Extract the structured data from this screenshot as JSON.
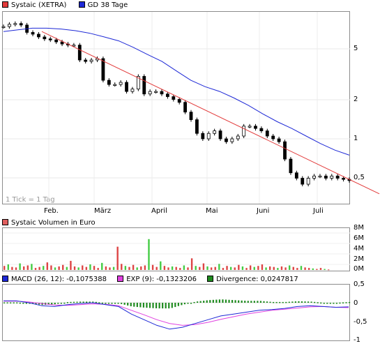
{
  "legend_price": [
    {
      "label": "Systaic (XETRA)",
      "color": "#e23a3a"
    },
    {
      "label": "GD 38 Tage",
      "color": "#1d28d6"
    }
  ],
  "legend_volume": {
    "label": "Systaic Volumen in Euro",
    "color": "#e06060"
  },
  "legend_macd": [
    {
      "label": "MACD (26, 12): -0,1075388",
      "color": "#1d28d6"
    },
    {
      "label": "EXP (9): -0,1323206",
      "color": "#e040e0"
    },
    {
      "label": "Divergence: 0,0247817",
      "color": "#1e8a1e"
    }
  ],
  "tick_note": "1 Tick = 1 Tag",
  "chart_data": [
    {
      "type": "candlestick",
      "title": "Systaic (XETRA)",
      "yscale": "log",
      "y_ticks": [
        "5",
        "2",
        "1",
        "0,5"
      ],
      "x_ticks": [
        "Feb.",
        "März",
        "April",
        "Mai",
        "Juni",
        "Juli"
      ],
      "series": [
        {
          "name": "Systaic (XETRA)",
          "values": [
            7.2,
            7.5,
            7.6,
            7.4,
            6.5,
            6.3,
            6.0,
            5.8,
            5.7,
            5.5,
            5.3,
            5.2,
            5.2,
            4.0,
            3.9,
            4.0,
            4.1,
            2.8,
            2.6,
            2.6,
            2.7,
            2.3,
            2.4,
            3.0,
            2.2,
            2.3,
            2.3,
            2.2,
            2.1,
            2.0,
            1.9,
            1.6,
            1.4,
            1.1,
            1.0,
            1.1,
            1.15,
            1.0,
            0.95,
            1.0,
            1.05,
            1.25,
            1.25,
            1.2,
            1.15,
            1.05,
            1.0,
            0.95,
            0.7,
            0.55,
            0.5,
            0.45,
            0.5,
            0.52,
            0.52,
            0.5,
            0.52,
            0.5,
            0.49,
            0.48
          ]
        },
        {
          "name": "GD 38 Tage",
          "values": [
            6.6,
            6.8,
            7.0,
            7.0,
            6.9,
            6.7,
            6.4,
            6.0,
            5.6,
            5.0,
            4.4,
            3.9,
            3.3,
            2.8,
            2.5,
            2.3,
            2.05,
            1.8,
            1.55,
            1.35,
            1.2,
            1.05,
            0.92,
            0.82,
            0.75
          ]
        }
      ],
      "trendline": {
        "from": 6.6,
        "to": 0.55
      }
    },
    {
      "type": "bar",
      "title": "Systaic Volumen in Euro",
      "y_ticks": [
        "8M",
        "6M",
        "4M",
        "2M",
        "0M"
      ],
      "ylim": [
        0,
        8
      ],
      "values": [
        0.8,
        1.1,
        0.6,
        0.5,
        1.3,
        0.7,
        0.9,
        1.2,
        0.4,
        0.6,
        0.8,
        1.5,
        0.9,
        0.5,
        0.7,
        1.0,
        0.6,
        1.8,
        0.7,
        0.5,
        0.9,
        0.6,
        1.1,
        0.8,
        0.4,
        1.4,
        0.7,
        0.5,
        0.6,
        4.6,
        1.2,
        0.8,
        0.6,
        1.0,
        0.5,
        0.7,
        0.9,
        6.1,
        1.0,
        0.6,
        1.7,
        0.8,
        0.5,
        0.7,
        0.6,
        0.4,
        0.9,
        0.5,
        2.3,
        0.8,
        0.6,
        1.3,
        0.7,
        0.5,
        0.6,
        1.2,
        0.4,
        0.8,
        0.6,
        0.5,
        1.0,
        0.7,
        0.4,
        0.9,
        0.6,
        0.8,
        1.1,
        0.5,
        0.7,
        0.6,
        0.4,
        0.7,
        0.5,
        0.9,
        0.6,
        0.4,
        0.8,
        0.5,
        0.4,
        0.3,
        0.2,
        0.4,
        0.2,
        0.1
      ]
    },
    {
      "type": "line",
      "title": "MACD",
      "y_ticks": [
        "0,5",
        "0",
        "-0,5",
        "-1"
      ],
      "ylim": [
        -1,
        0.5
      ],
      "series": [
        {
          "name": "MACD (26, 12)",
          "values": [
            0.05,
            0.05,
            0.0,
            -0.08,
            -0.1,
            -0.05,
            -0.02,
            0.0,
            -0.05,
            -0.1,
            -0.3,
            -0.45,
            -0.6,
            -0.7,
            -0.65,
            -0.55,
            -0.45,
            -0.35,
            -0.3,
            -0.25,
            -0.2,
            -0.18,
            -0.15,
            -0.1,
            -0.08,
            -0.1,
            -0.12,
            -0.11
          ]
        },
        {
          "name": "EXP (9)",
          "values": [
            0.04,
            0.04,
            0.02,
            -0.02,
            -0.06,
            -0.07,
            -0.05,
            -0.03,
            -0.04,
            -0.08,
            -0.2,
            -0.32,
            -0.45,
            -0.55,
            -0.6,
            -0.58,
            -0.52,
            -0.44,
            -0.37,
            -0.3,
            -0.25,
            -0.2,
            -0.17,
            -0.14,
            -0.11,
            -0.1,
            -0.12,
            -0.13
          ]
        }
      ],
      "divergence": [
        0.01,
        0.01,
        -0.02,
        -0.06,
        -0.04,
        0.02,
        0.03,
        0.03,
        -0.01,
        -0.02,
        -0.1,
        -0.13,
        -0.15,
        -0.15,
        -0.05,
        0.03,
        0.07,
        0.09,
        0.07,
        0.05,
        0.05,
        0.02,
        0.02,
        0.04,
        0.03,
        0.0,
        0.0,
        0.02
      ]
    }
  ]
}
